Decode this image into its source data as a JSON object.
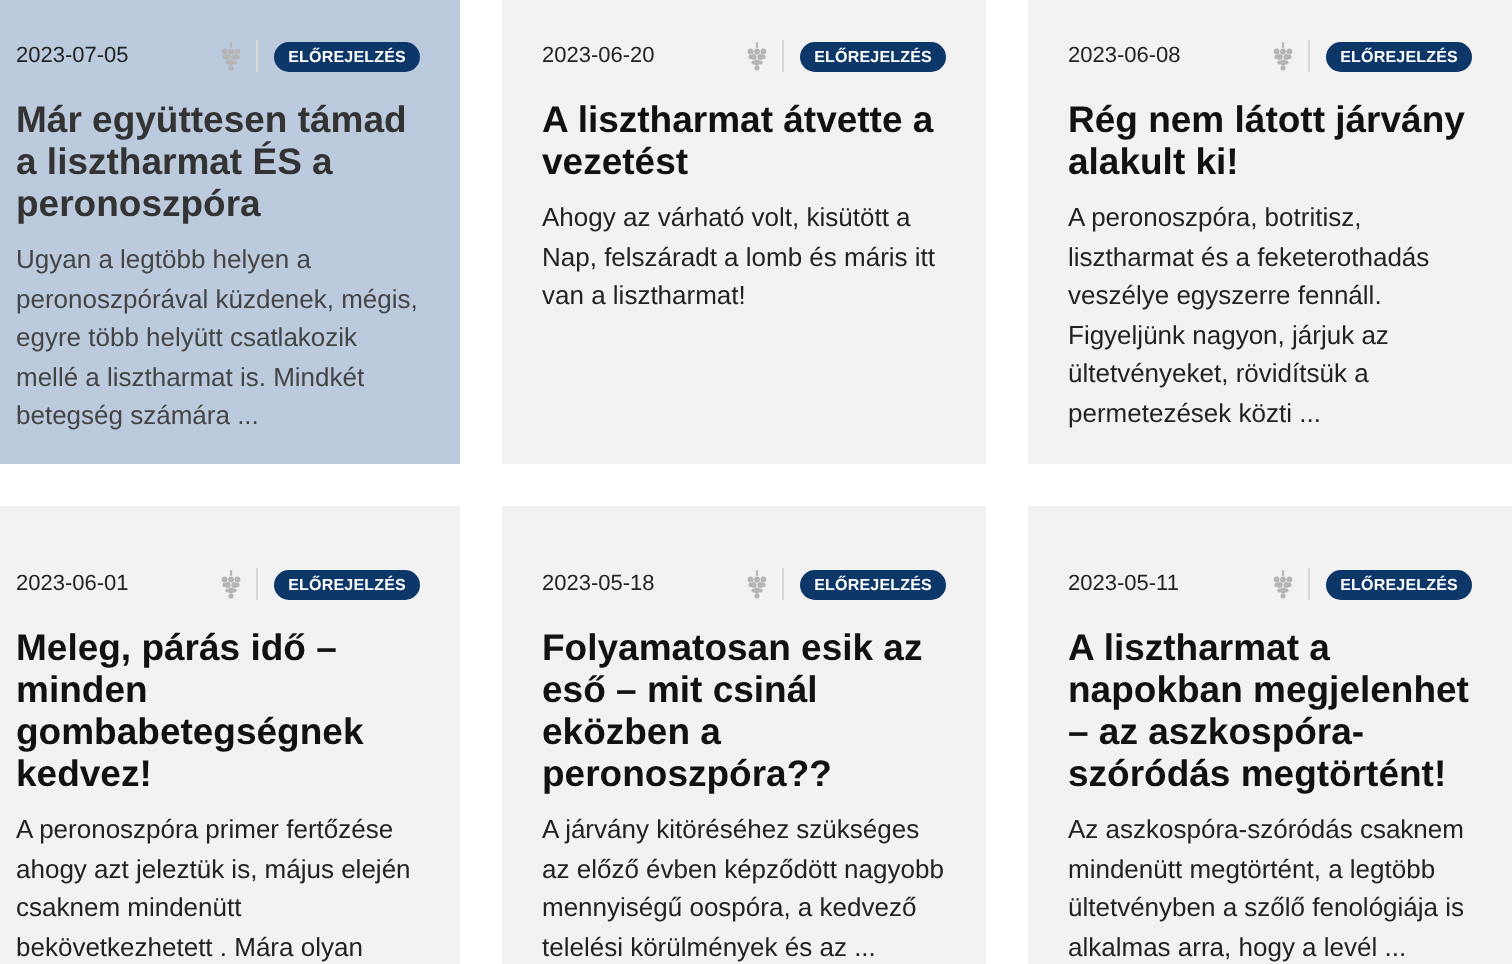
{
  "articles": [
    {
      "date": "2023-07-05",
      "tag": "ELŐREJELZÉS",
      "title": "Már együttesen támad a lisztharmat ÉS a peronoszpóra",
      "excerpt": "Ugyan a legtöbb helyen a peronoszpórával küzdenek, mégis, egyre több helyütt csatlakozik mellé a lisztharmat is. Mindkét betegség számára ...",
      "highlighted": true
    },
    {
      "date": "2023-06-20",
      "tag": "ELŐREJELZÉS",
      "title": "A lisztharmat átvette a vezetést",
      "excerpt": "Ahogy az várható volt, kisütött a Nap, felszáradt a lomb és máris itt van a lisztharmat!",
      "highlighted": false
    },
    {
      "date": "2023-06-08",
      "tag": "ELŐREJELZÉS",
      "title": "Rég nem látott járvány alakult ki!",
      "excerpt": "A peronoszpóra, botritisz, lisztharmat és a feketerothadás veszélye egyszerre fennáll. Figyeljünk nagyon, járjuk az ültetvényeket, rövidítsük a permetezések közti ...",
      "highlighted": false
    },
    {
      "date": "2023-06-01",
      "tag": "ELŐREJELZÉS",
      "title": "Meleg, párás idő – minden gombabetegségnek kedvez!",
      "excerpt": "A peronoszpóra primer fertőzése ahogy azt jeleztük is, május elején csaknem mindenütt bekövetkezhetett . Mára olyan",
      "highlighted": false
    },
    {
      "date": "2023-05-18",
      "tag": "ELŐREJELZÉS",
      "title": "Folyamatosan esik az eső – mit csinál eközben a peronoszpóra??",
      "excerpt": "A járvány kitöréséhez szükséges az előző évben képződött nagyobb mennyiségű oospóra, a kedvező telelési körülmények és az ...",
      "highlighted": false
    },
    {
      "date": "2023-05-11",
      "tag": "ELŐREJELZÉS",
      "title": "A lisztharmat a napokban megjelenhet – az aszkospóra-szóródás megtörtént!",
      "excerpt": "Az aszkospóra-szóródás csaknem mindenütt megtörtént, a legtöbb ültetvényben a szőlő fenológiája is alkalmas arra, hogy a levél ...",
      "highlighted": false
    }
  ]
}
